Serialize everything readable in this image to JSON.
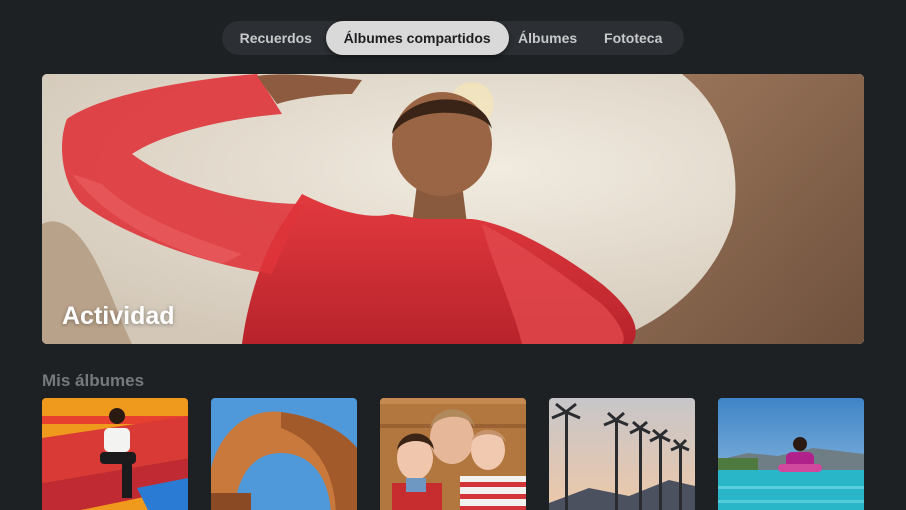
{
  "tabs": [
    {
      "label": "Recuerdos",
      "selected": false
    },
    {
      "label": "Álbumes compartidos",
      "selected": true
    },
    {
      "label": "Álbumes",
      "selected": false
    },
    {
      "label": "Fototeca",
      "selected": false
    }
  ],
  "hero": {
    "title": "Actividad"
  },
  "albums_section": {
    "title": "Mis álbumes"
  },
  "colors": {
    "background": "#1e2124",
    "tabbar": "#2c2f33",
    "selected_tab": "#d9d9da",
    "hero_red": "#d42a31"
  }
}
